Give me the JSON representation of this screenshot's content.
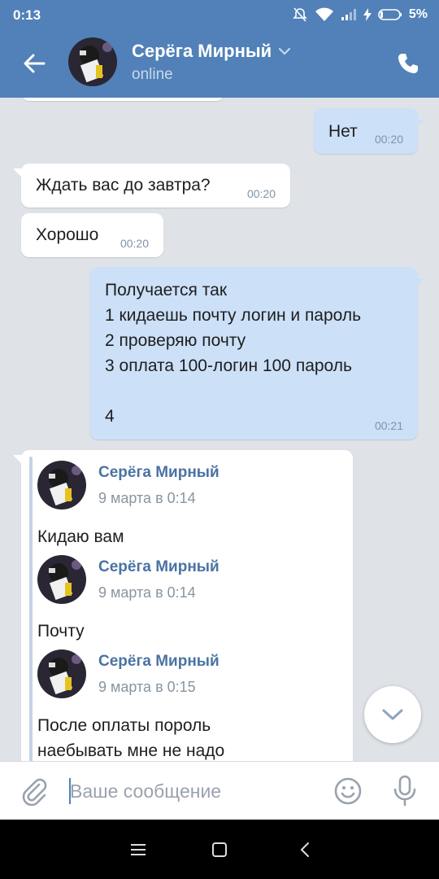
{
  "status_bar": {
    "time": "0:13",
    "battery": "5%"
  },
  "header": {
    "name": "Серёга Мирный",
    "status": "online"
  },
  "messages": [
    {
      "direction": "out",
      "text": "Нет",
      "time": "00:20"
    },
    {
      "direction": "in",
      "text": "Ждать вас до завтра?",
      "time": "00:20"
    },
    {
      "direction": "in",
      "text": "Хорошо",
      "time": "00:20"
    },
    {
      "direction": "out",
      "text": "Получается так\n1 кидаешь почту логин и пароль\n2 проверяю почту\n3 оплата 100-логин 100 пароль\n\n4",
      "time": "00:21"
    }
  ],
  "forwarded": [
    {
      "author": "Серёга Мирный",
      "date": "9 марта в 0:14",
      "text": "Кидаю вам"
    },
    {
      "author": "Серёга Мирный",
      "date": "9 марта в 0:14",
      "text": "Почту"
    },
    {
      "author": "Серёга Мирный",
      "date": "9 марта в 0:15",
      "text": "После оплаты пороль\nнаебывать мне не надо"
    }
  ],
  "composer": {
    "placeholder": "Ваше сообщение"
  },
  "icons": {
    "back": "arrow-left-icon",
    "call": "phone-icon",
    "attach": "paperclip-icon",
    "emoji": "smiley-icon",
    "mic": "microphone-icon",
    "scroll_down": "chevron-down-icon"
  },
  "colors": {
    "header": "#5181b8",
    "outgoing_bubble": "#cce0f8",
    "incoming_bubble": "#ffffff",
    "chat_background": "#dfe3e8",
    "author_name": "#4a73a3"
  }
}
